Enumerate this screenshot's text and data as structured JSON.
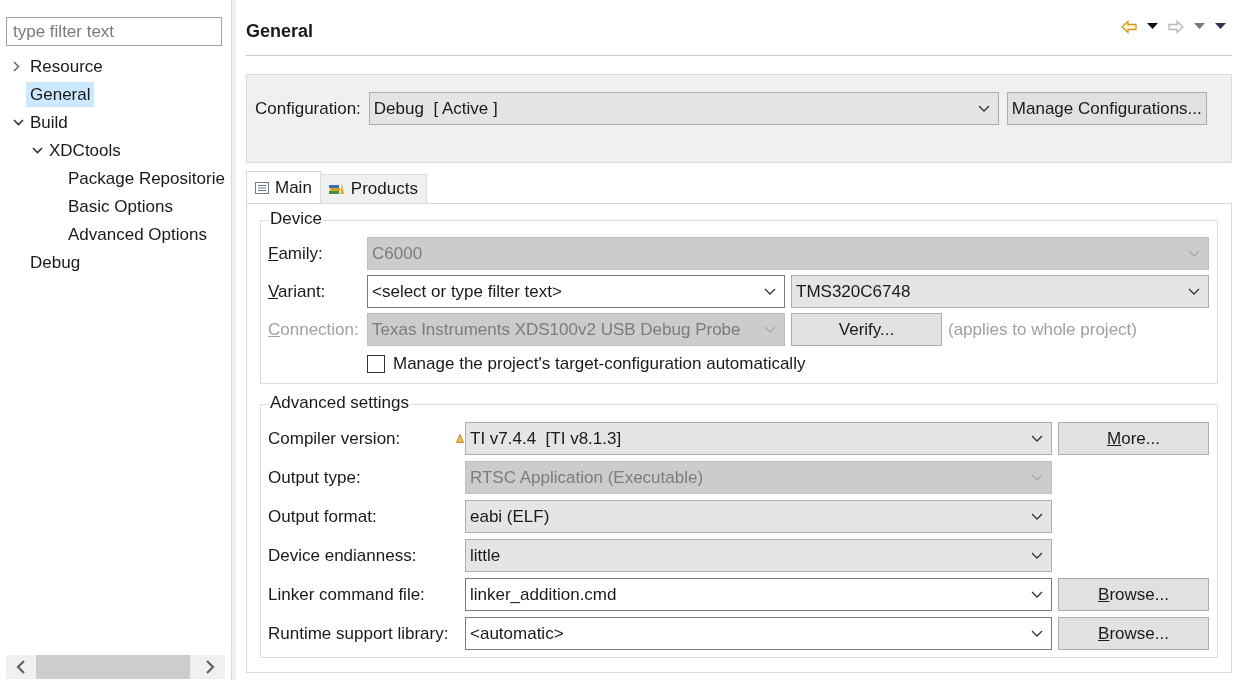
{
  "filter": {
    "placeholder": "type filter text"
  },
  "tree": [
    {
      "label": "Resource",
      "expanded": false,
      "selected": false
    },
    {
      "label": "General",
      "selected": true
    },
    {
      "label": "Build",
      "expanded": true,
      "selected": false,
      "children": [
        {
          "label": "XDCtools",
          "expanded": true,
          "selected": false,
          "children": [
            {
              "label": "Package Repositorie",
              "selected": false
            },
            {
              "label": "Basic Options",
              "selected": false
            },
            {
              "label": "Advanced Options",
              "selected": false
            }
          ]
        }
      ]
    },
    {
      "label": "Debug",
      "selected": false
    }
  ],
  "header": {
    "title": "General"
  },
  "configuration": {
    "label": "Configuration:",
    "value": "Debug  [ Active ]",
    "button": "Manage Configurations..."
  },
  "tabs": [
    {
      "label": "Main",
      "kind": "list",
      "selected": true
    },
    {
      "label": "Products",
      "kind": "books",
      "selected": false
    }
  ],
  "device": {
    "title": "Device",
    "family": {
      "label": "Family:",
      "mnemonic": true,
      "disabled": false,
      "combo": {
        "value": "C6000",
        "disabled": true
      }
    },
    "variant": {
      "label": "Variant:",
      "mnemonic": true,
      "disabled": false,
      "combo": {
        "value": "<select or type filter text>",
        "editable": true,
        "disabled": false
      },
      "combo_2": {
        "value": "TMS320C6748",
        "editable": false,
        "disabled": false
      }
    },
    "connection": {
      "label": "Connection:",
      "mnemonic": true,
      "disabled": true,
      "combo": {
        "value": "Texas Instruments XDS100v2 USB Debug Probe",
        "disabled": true
      },
      "button": "Verify...",
      "note": "(applies to whole project)"
    },
    "checkbox": {
      "label": "Manage the project's target-configuration automatically",
      "checked": false
    }
  },
  "advanced": {
    "title": "Advanced settings",
    "rows": [
      {
        "label": "Compiler version:",
        "warning": true,
        "combo": {
          "value": "TI v7.4.4  [TI v8.1.3]",
          "editable": false,
          "disabled": false
        },
        "button": "More..."
      },
      {
        "label": "Output type:",
        "warning": false,
        "combo": {
          "value": "RTSC Application (Executable)",
          "disabled": true
        }
      },
      {
        "label": "Output format:",
        "warning": false,
        "combo": {
          "value": "eabi (ELF)",
          "editable": false,
          "disabled": false
        }
      },
      {
        "label": "Device endianness:",
        "warning": false,
        "combo": {
          "value": "little",
          "editable": false,
          "disabled": false
        }
      },
      {
        "label": "Linker command file:",
        "warning": false,
        "combo": {
          "value": "linker_addition.cmd",
          "editable": true,
          "disabled": false
        },
        "button": "Browse..."
      },
      {
        "label": "Runtime support library:",
        "warning": false,
        "combo": {
          "value": "<automatic>",
          "editable": true,
          "disabled": false
        },
        "button": "Browse..."
      }
    ]
  }
}
